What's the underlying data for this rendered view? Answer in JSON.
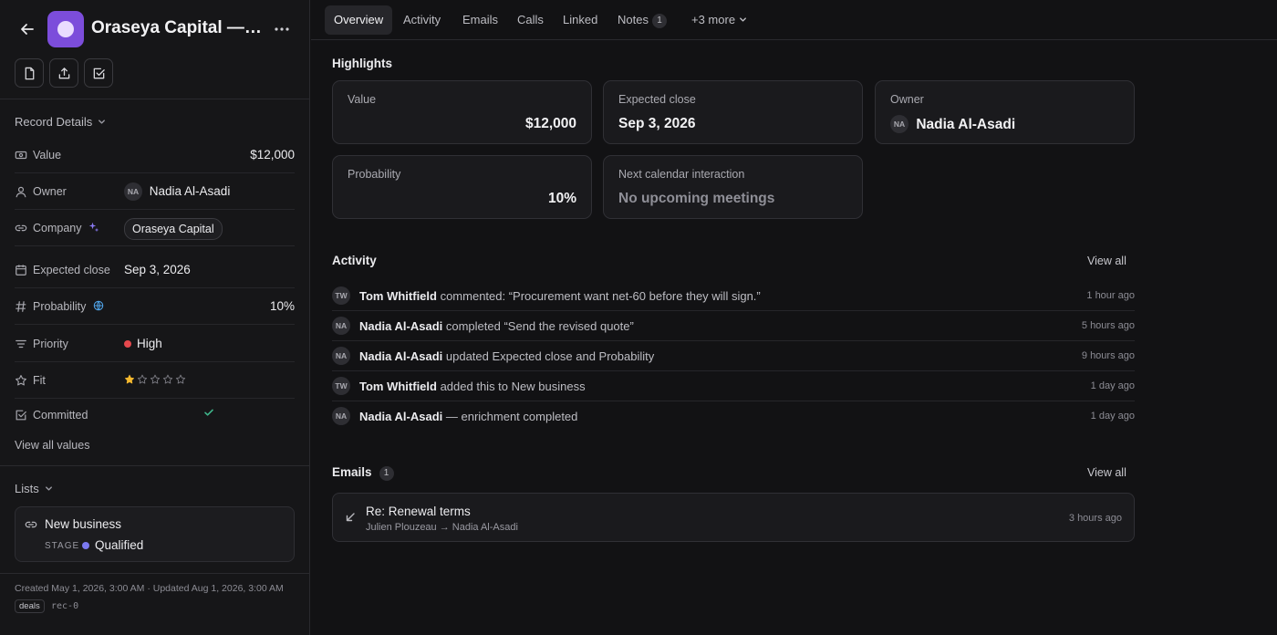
{
  "header": {
    "title": "Oraseya Capital — S…"
  },
  "record_details": {
    "heading": "Record Details",
    "fields": {
      "value": {
        "label": "Value",
        "value": "$12,000"
      },
      "owner": {
        "label": "Owner",
        "initials": "NA",
        "value": "Nadia Al-Asadi"
      },
      "company": {
        "label": "Company",
        "value": "Oraseya Capital"
      },
      "expected_close": {
        "label": "Expected close",
        "value": "Sep 3, 2026"
      },
      "probability": {
        "label": "Probability",
        "value": "10%"
      },
      "priority": {
        "label": "Priority",
        "value": "High",
        "color": "#e5484d"
      },
      "fit": {
        "label": "Fit",
        "rating": 1,
        "max": 5,
        "star_color": "#f5b82e"
      },
      "committed": {
        "label": "Committed",
        "checked": true,
        "check_color": "#3fb68b"
      }
    },
    "view_all": "View all values"
  },
  "lists": {
    "heading": "Lists",
    "items": [
      {
        "name": "New business",
        "stage_label": "STAGE",
        "stage": "Qualified",
        "stage_color": "#7b79f0"
      }
    ]
  },
  "footer": {
    "meta": "Created May 1, 2026, 3:00 AM · Updated Aug 1, 2026, 3:00 AM",
    "tag": "deals",
    "record_id": "rec-0"
  },
  "tabs": [
    {
      "label": "Overview",
      "active": true
    },
    {
      "label": "Activity"
    },
    {
      "label": "Emails"
    },
    {
      "label": "Calls"
    },
    {
      "label": "Linked"
    },
    {
      "label": "Notes",
      "count": "1"
    },
    {
      "label": "+3 more"
    }
  ],
  "highlights": {
    "heading": "Highlights",
    "cards": [
      {
        "label": "Value",
        "value": "$12,000"
      },
      {
        "label": "Expected close",
        "value": "Sep 3, 2026"
      },
      {
        "label": "Owner",
        "initials": "NA",
        "value": "Nadia Al-Asadi"
      },
      {
        "label": "Probability",
        "value": "10%"
      },
      {
        "label": "Next calendar interaction",
        "value": "No upcoming meetings"
      }
    ]
  },
  "activity": {
    "heading": "Activity",
    "view_all": "View all",
    "items": [
      {
        "initials": "TW",
        "actor": "Tom Whitfield",
        "text": " commented: “Procurement want net-60 before they will sign.”",
        "time": "1 hour ago"
      },
      {
        "initials": "NA",
        "actor": "Nadia Al-Asadi",
        "text": " completed “Send the revised quote”",
        "time": "5 hours ago"
      },
      {
        "initials": "NA",
        "actor": "Nadia Al-Asadi",
        "text": " updated Expected close and Probability",
        "time": "9 hours ago"
      },
      {
        "initials": "TW",
        "actor": "Tom Whitfield",
        "text": " added this to New business",
        "time": "1 day ago"
      },
      {
        "initials": "NA",
        "actor": "Nadia Al-Asadi",
        "text": " — enrichment completed",
        "time": "1 day ago"
      }
    ]
  },
  "emails": {
    "heading": "Emails",
    "count": "1",
    "view_all": "View all",
    "items": [
      {
        "subject": "Re: Renewal terms",
        "participants": "Julien Plouzeau → Nadia Al-Asadi",
        "time": "3 hours ago"
      }
    ]
  }
}
